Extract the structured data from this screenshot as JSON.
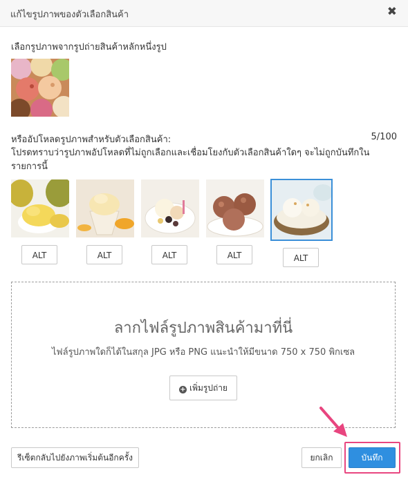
{
  "dialog": {
    "title": "แก้ไขรูปภาพของตัวเลือกสินค้า",
    "close_icon": "close-icon"
  },
  "main_image": {
    "label": "เลือกรูปภาพจากรูปถ่ายสินค้าหลักหนึ่งรูป"
  },
  "upload": {
    "label": "หรืออัปโหลดรูปภาพสำหรับตัวเลือกสินค้า:",
    "count": "5/100",
    "note": "โปรดทราบว่ารูปภาพอัปโหลดที่ไม่ถูกเลือกและเชื่อมโยงกับตัวเลือกสินค้าใดๆ จะไม่ถูกบันทึกในรายการนี้",
    "images": [
      {
        "alt_label": "ALT",
        "selected": false
      },
      {
        "alt_label": "ALT",
        "selected": false
      },
      {
        "alt_label": "ALT",
        "selected": false
      },
      {
        "alt_label": "ALT",
        "selected": false
      },
      {
        "alt_label": "ALT",
        "selected": true
      }
    ]
  },
  "dropzone": {
    "title": "ลากไฟล์รูปภาพสินค้ามาที่นี่",
    "hint": "ไฟล์รูปภาพใดก็ได้ในสกุล JPG หรือ PNG แนะนำให้มีขนาด 750 x 750 พิกเซล",
    "add_button_label": "เพิ่มรูปถ่าย"
  },
  "footer": {
    "reset_label": "รีเซ็ตกลับไปยังภาพเริ่มต้นอีกครั้ง",
    "cancel_label": "ยกเลิก",
    "save_label": "บันทึก"
  },
  "colors": {
    "accent": "#2f8fe0",
    "highlight": "#e8457f"
  }
}
